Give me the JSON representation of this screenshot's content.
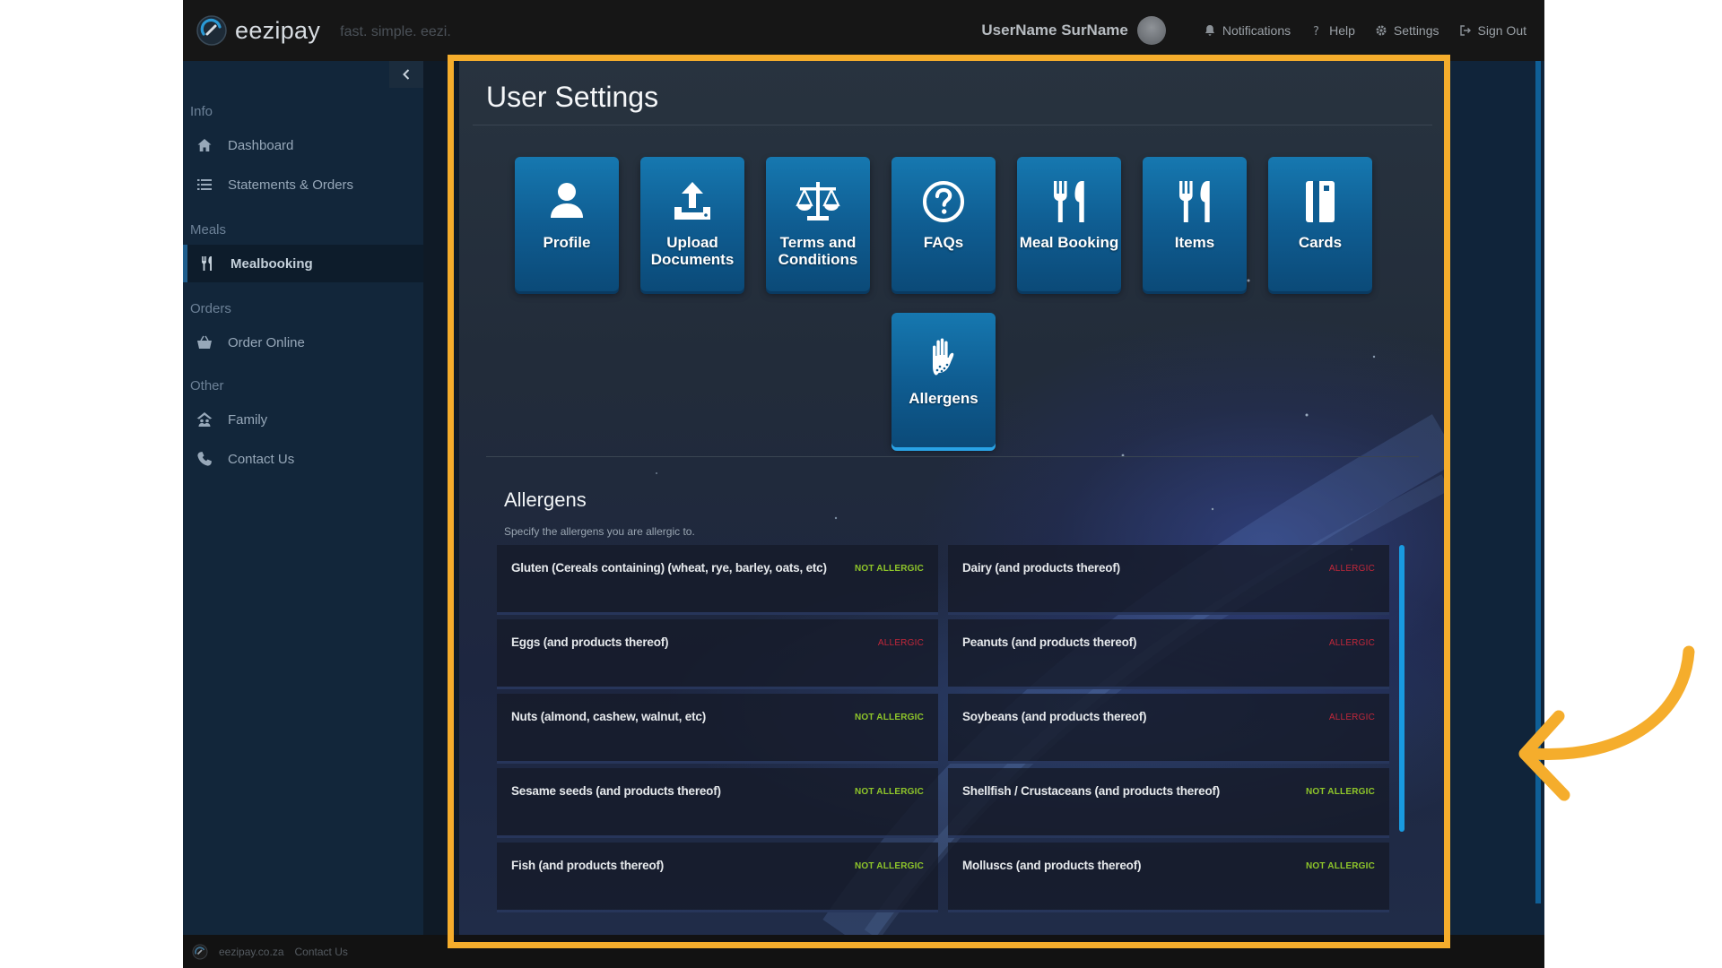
{
  "brand": {
    "name": "eezipay",
    "tagline": "fast. simple. eezi."
  },
  "topbar": {
    "username": "UserName SurName",
    "notifications": "Notifications",
    "help": "Help",
    "settings": "Settings",
    "sign_out": "Sign Out"
  },
  "sidebar": {
    "sections": {
      "info": "Info",
      "meals": "Meals",
      "orders": "Orders",
      "other": "Other"
    },
    "items": {
      "dashboard": "Dashboard",
      "statements": "Statements & Orders",
      "mealbooking": "Mealbooking",
      "order_online": "Order Online",
      "family": "Family",
      "contact": "Contact Us"
    }
  },
  "main": {
    "title": "User Settings",
    "tiles": [
      {
        "label": "Profile",
        "icon": "user-icon"
      },
      {
        "label": "Upload Documents",
        "icon": "upload-icon"
      },
      {
        "label": "Terms and Conditions",
        "icon": "scales-icon"
      },
      {
        "label": "FAQs",
        "icon": "question-icon"
      },
      {
        "label": "Meal Booking",
        "icon": "cutlery-icon"
      },
      {
        "label": "Items",
        "icon": "cutlery-icon"
      },
      {
        "label": "Cards",
        "icon": "card-icon"
      },
      {
        "label": "Allergens",
        "icon": "hand-icon"
      }
    ],
    "allergens": {
      "title": "Allergens",
      "subtitle": "Specify the allergens you are allergic to.",
      "items": [
        {
          "name": "Gluten (Cereals containing) (wheat, rye, barley, oats, etc)",
          "status": "NOT ALLERGIC"
        },
        {
          "name": "Dairy (and products thereof)",
          "status": "ALLERGIC"
        },
        {
          "name": "Eggs (and products thereof)",
          "status": "ALLERGIC"
        },
        {
          "name": "Peanuts (and products thereof)",
          "status": "ALLERGIC"
        },
        {
          "name": "Nuts (almond, cashew, walnut, etc)",
          "status": "NOT ALLERGIC"
        },
        {
          "name": "Soybeans (and products thereof)",
          "status": "ALLERGIC"
        },
        {
          "name": "Sesame seeds (and products thereof)",
          "status": "NOT ALLERGIC"
        },
        {
          "name": "Shellfish / Crustaceans (and products thereof)",
          "status": "NOT ALLERGIC"
        },
        {
          "name": "Fish (and products thereof)",
          "status": "NOT ALLERGIC"
        },
        {
          "name": "Molluscs (and products thereof)",
          "status": "NOT ALLERGIC"
        }
      ]
    }
  },
  "footer": {
    "site": "eezipay.co.za",
    "contact": "Contact Us"
  },
  "colors": {
    "highlight": "#f5ad2c",
    "tile": "#1678b0",
    "not_allergic": "#8fc62a",
    "allergic": "#c1273a",
    "scrollbar": "#199ae0"
  }
}
